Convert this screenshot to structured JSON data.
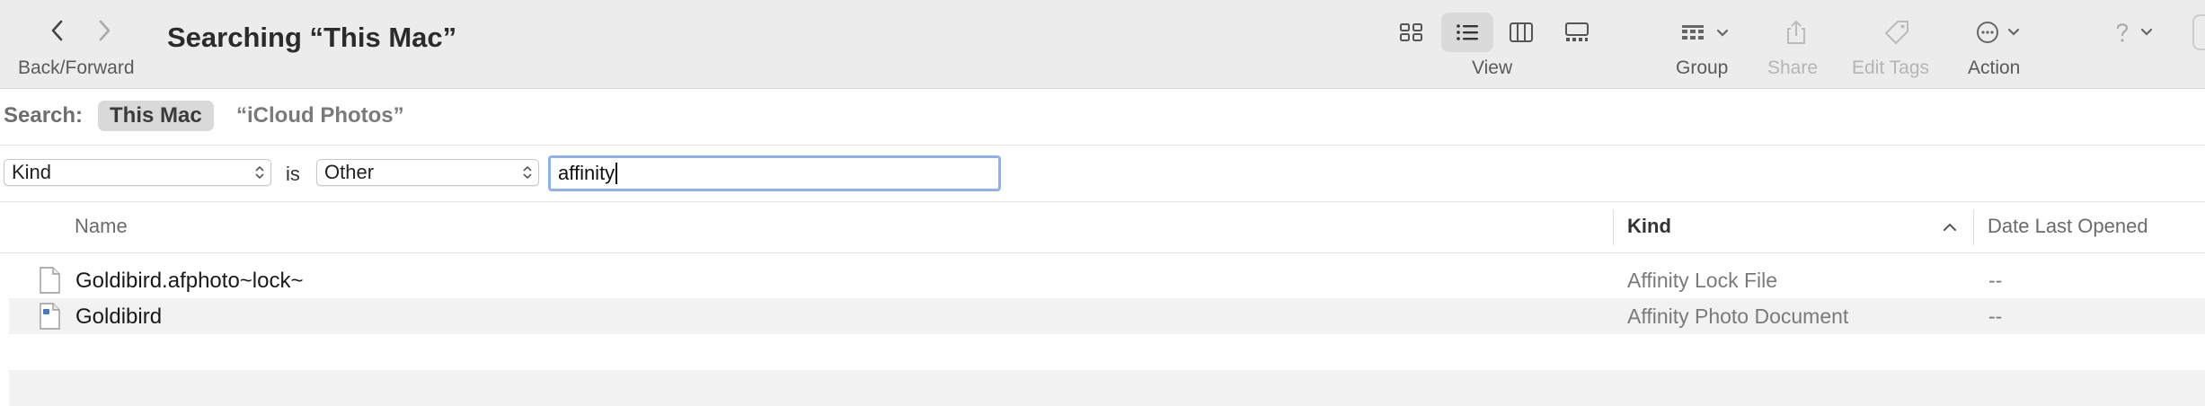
{
  "toolbar": {
    "back_forward_label": "Back/Forward",
    "title": "Searching “This Mac”",
    "view_label": "View",
    "group_label": "Group",
    "share_label": "Share",
    "edit_tags_label": "Edit Tags",
    "action_label": "Action",
    "active_view": "list"
  },
  "scope": {
    "label": "Search:",
    "selected": "This Mac",
    "other": "“iCloud Photos”"
  },
  "criteria": {
    "attribute": "Kind",
    "operator": "is",
    "value_select": "Other",
    "text_value": "affinity"
  },
  "columns": {
    "name": "Name",
    "kind": "Kind",
    "date_last_opened": "Date Last Opened",
    "sorted_by": "Kind"
  },
  "files": [
    {
      "name": "Goldibird.afphoto~lock~",
      "kind": "Affinity Lock File",
      "date_last_opened": "--",
      "icon": "generic-file-icon"
    },
    {
      "name": "Goldibird",
      "kind": "Affinity Photo Document",
      "date_last_opened": "--",
      "icon": "affinity-document-icon"
    }
  ],
  "colors": {
    "toolbar_bg": "#ececec",
    "accent_focus": "#8fb2ee",
    "alt_row": "#f2f2f2"
  }
}
